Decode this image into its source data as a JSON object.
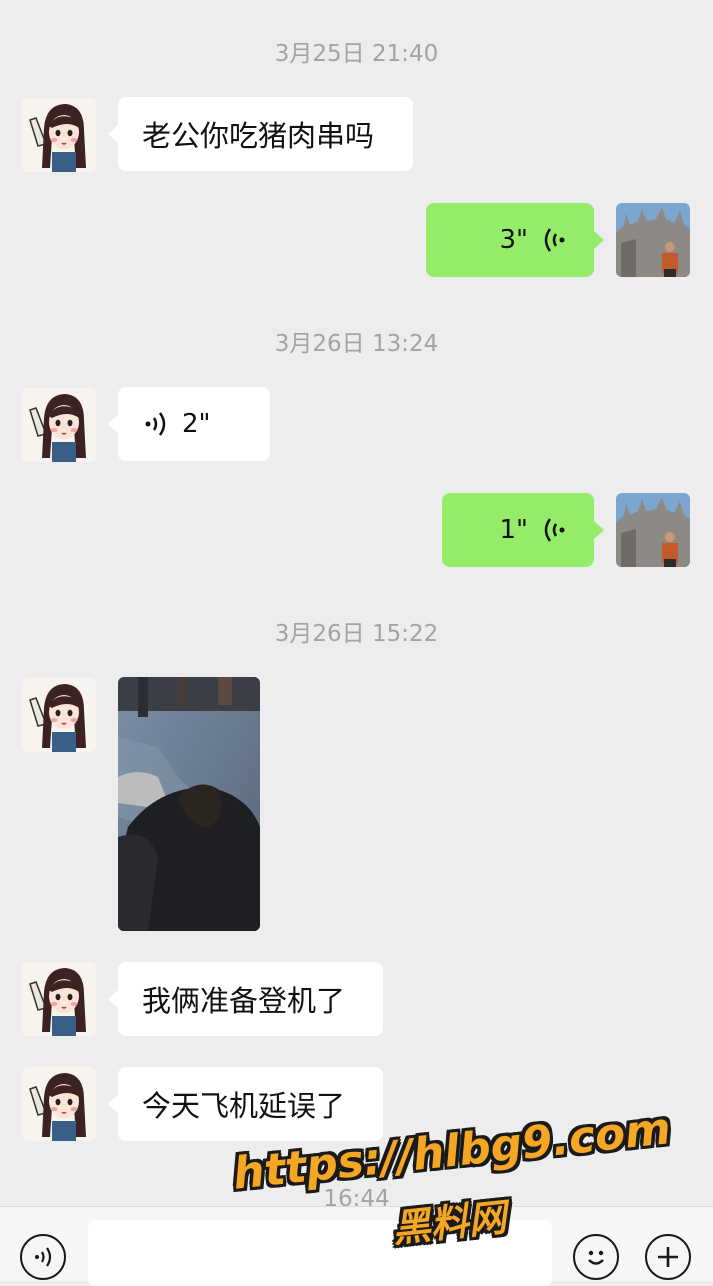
{
  "messages": {
    "ts1": "3月25日 21:40",
    "m1_text": "老公你吃猪肉串吗",
    "m2_duration": "3\"",
    "ts2": "3月26日 13:24",
    "m3_duration": "2\"",
    "m4_duration": "1\"",
    "ts3": "3月26日 15:22",
    "m6_text": "我俩准备登机了",
    "m7_text": "今天飞机延误了",
    "ts4_partial": "16:44"
  },
  "colors": {
    "background": "#ededed",
    "sent_bubble": "#95ec69",
    "received_bubble": "#ffffff",
    "timestamp": "#a3a3a3"
  },
  "icons": {
    "voice_input": "voice-icon",
    "emoji": "emoji-icon",
    "more": "plus-icon",
    "voice_message": "voice-wave-icon"
  },
  "watermark": {
    "url": "https://hlbg9.com",
    "name": "黑料网"
  }
}
